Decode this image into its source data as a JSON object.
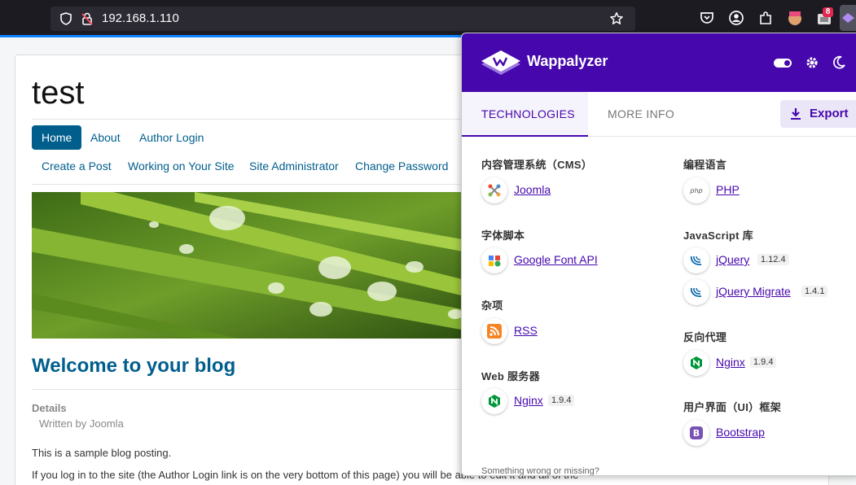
{
  "browser": {
    "url": "192.168.1.110",
    "extension_badge_count": "8",
    "accent": "#0a84ff"
  },
  "site": {
    "title": "test",
    "main_menu": [
      "Home",
      "About",
      "Author Login"
    ],
    "user_menu": [
      "Create a Post",
      "Working on Your Site",
      "Site Administrator",
      "Change Password"
    ],
    "post_title": "Welcome to your blog",
    "details_label": "Details",
    "details_author": "Written by Joomla",
    "paragraph_1": "This is a sample blog posting.",
    "paragraph_2": "If you log in to the site (the Author Login link is on the very bottom of this page) you will be able to edit it and all of the",
    "link_color": "#005e8d"
  },
  "wappalyzer": {
    "brand": "Wappalyzer",
    "brand_color": "#4608ad",
    "tabs": [
      "TECHNOLOGIES",
      "MORE INFO"
    ],
    "export_label": "Export",
    "footer": "Something wrong or missing?",
    "left_column": [
      {
        "category": "内容管理系统（CMS）",
        "items": [
          {
            "name": "Joomla",
            "version": "",
            "icon": "joomla-icon"
          }
        ]
      },
      {
        "category": "字体脚本",
        "items": [
          {
            "name": "Google Font API",
            "version": "",
            "icon": "google-font-api-icon"
          }
        ]
      },
      {
        "category": "杂项",
        "items": [
          {
            "name": "RSS",
            "version": "",
            "icon": "rss-icon"
          }
        ]
      },
      {
        "category": "Web 服务器",
        "items": [
          {
            "name": "Nginx",
            "version": "1.9.4",
            "icon": "nginx-icon"
          }
        ]
      }
    ],
    "right_column": [
      {
        "category": "编程语言",
        "items": [
          {
            "name": "PHP",
            "version": "",
            "icon": "php-icon"
          }
        ]
      },
      {
        "category": "JavaScript 库",
        "items": [
          {
            "name": "jQuery",
            "version": "1.12.4",
            "icon": "jquery-icon"
          },
          {
            "name": "jQuery Migrate",
            "version": "1.4.1",
            "icon": "jquery-icon"
          }
        ]
      },
      {
        "category": "反向代理",
        "items": [
          {
            "name": "Nginx",
            "version": "1.9.4",
            "icon": "nginx-icon"
          }
        ]
      },
      {
        "category": "用户界面（UI）框架",
        "items": [
          {
            "name": "Bootstrap",
            "version": "",
            "icon": "bootstrap-icon"
          }
        ]
      }
    ]
  }
}
